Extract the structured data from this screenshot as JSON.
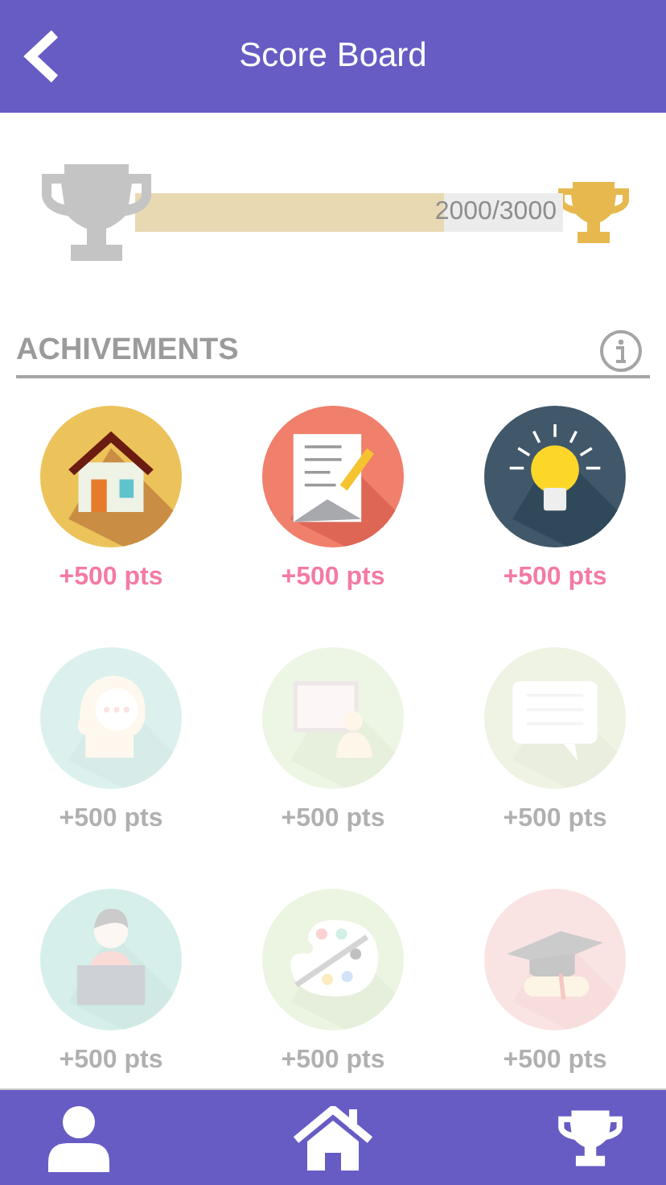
{
  "header": {
    "title": "Score Board"
  },
  "progress": {
    "level": 0.72,
    "reading": "2000/3000"
  },
  "section": {
    "title": "ACHIVEMENTS"
  },
  "achievements": [
    {
      "kind": "house",
      "points": "+500 pts",
      "unlocked": true
    },
    {
      "kind": "letter",
      "points": "+500 pts",
      "unlocked": true
    },
    {
      "kind": "bulb",
      "points": "+500 pts",
      "unlocked": true
    },
    {
      "kind": "head",
      "points": "+500 pts",
      "unlocked": false
    },
    {
      "kind": "teacher",
      "points": "+500 pts",
      "unlocked": false
    },
    {
      "kind": "chat",
      "points": "+500 pts",
      "unlocked": false
    },
    {
      "kind": "reader",
      "points": "+500 pts",
      "unlocked": false
    },
    {
      "kind": "palette",
      "points": "+500 pts",
      "unlocked": false
    },
    {
      "kind": "graduation",
      "points": "+500 pts",
      "unlocked": false
    }
  ]
}
